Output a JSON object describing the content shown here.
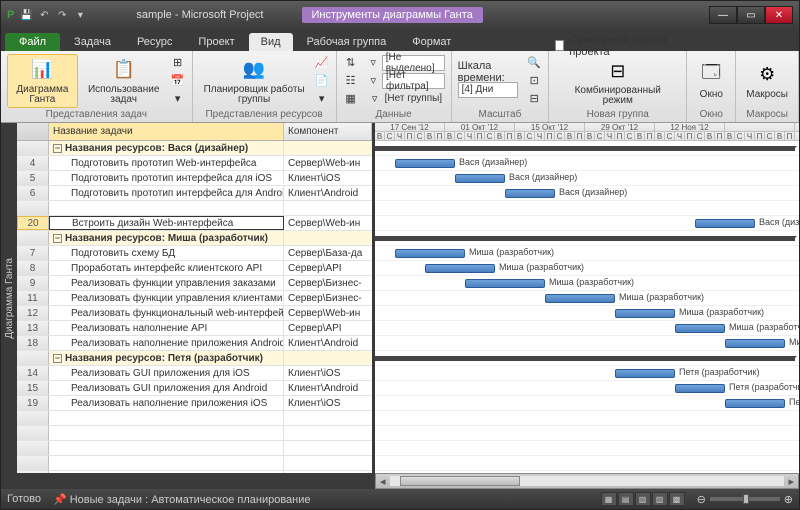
{
  "title": "sample - Microsoft Project",
  "context_tab": "Инструменты диаграммы Ганта",
  "file_tab": "Файл",
  "tabs": [
    "Задача",
    "Ресурс",
    "Проект",
    "Вид",
    "Рабочая группа",
    "Формат"
  ],
  "active_tab_index": 3,
  "ribbon": {
    "group_views_label": "Представления задач",
    "gantt_btn": "Диаграмма\nГанта",
    "usage_btn": "Использование\nзадач",
    "group_res_label": "Представления ресурсов",
    "planner_btn": "Планировщик\nработы группы",
    "group_data_label": "Данные",
    "data_rows": [
      "[Не выделено]",
      "[Нет фильтра]",
      "[Нет группы]"
    ],
    "group_scale_label": "Масштаб",
    "scale_label": "Шкала времени:",
    "scale_value": "[4] Дни",
    "group_combo_label": "Новая группа",
    "combo_btn": "Комбинированный\nрежим",
    "combo_chk": "Суммарная задача проекта",
    "group_window_label": "Окно",
    "window_btn": "Окно",
    "group_macros_label": "Макросы",
    "macros_btn": "Макросы"
  },
  "grid": {
    "col_name": "Название задачи",
    "col_comp": "Компонент",
    "rows": [
      {
        "num": "",
        "group": true,
        "name": "Названия ресурсов: Вася (дизайнер)",
        "comp": ""
      },
      {
        "num": "4",
        "name": "Подготовить прототип Web-интерфейса",
        "comp": "Сервер\\Web-ин"
      },
      {
        "num": "5",
        "name": "Подготовить прототип интерфейса для iOS",
        "comp": "Клиент\\iOS"
      },
      {
        "num": "6",
        "name": "Подготовить прототип интерфейса для Android",
        "comp": "Клиент\\Android"
      },
      {
        "num": "",
        "blank": true
      },
      {
        "num": "20",
        "selected": true,
        "name": "Встроить дизайн Web-интерфейса",
        "comp": "Сервер\\Web-ин"
      },
      {
        "num": "",
        "group": true,
        "name": "Названия ресурсов: Миша (разработчик)",
        "comp": ""
      },
      {
        "num": "7",
        "name": "Подготовить схему БД",
        "comp": "Сервер\\База-да"
      },
      {
        "num": "8",
        "name": "Проработать интерфейс клиентского API",
        "comp": "Сервер\\API"
      },
      {
        "num": "9",
        "name": "Реализовать функции управления заказами",
        "comp": "Сервер\\Бизнес-"
      },
      {
        "num": "11",
        "name": "Реализовать функции управления клиентами",
        "comp": "Сервер\\Бизнес-"
      },
      {
        "num": "12",
        "name": "Реализовать функциональный web-интерфейс",
        "comp": "Сервер\\Web-ин"
      },
      {
        "num": "13",
        "name": "Реализовать наполнение API",
        "comp": "Сервер\\API"
      },
      {
        "num": "18",
        "name": "Реализовать наполнение приложения Android",
        "comp": "Клиент\\Android"
      },
      {
        "num": "",
        "group": true,
        "name": "Названия ресурсов: Петя (разработчик)",
        "comp": ""
      },
      {
        "num": "14",
        "name": "Реализовать GUI приложения для iOS",
        "comp": "Клиент\\iOS"
      },
      {
        "num": "15",
        "name": "Реализовать GUI приложения для Android",
        "comp": "Клиент\\Android"
      },
      {
        "num": "19",
        "name": "Реализовать наполнение приложения iOS",
        "comp": "Клиент\\iOS"
      }
    ]
  },
  "timescale": {
    "top": [
      "17 Сен '12",
      "01 Окт '12",
      "15 Окт '12",
      "29 Окт '12",
      "12 Ноя '12"
    ],
    "bot_pattern": [
      "В",
      "С",
      "Ч",
      "П",
      "С",
      "В",
      "П"
    ]
  },
  "task_label": {
    "vasya": "Вася (дизайнер)",
    "misha": "Миша (разработчик)",
    "petya": "Петя (разработчик)",
    "names": "Названия ресур"
  },
  "status": {
    "ready": "Готово",
    "mode": "Новые задачи : Автоматическое планирование"
  },
  "side_label": "Диаграмма Ганта"
}
